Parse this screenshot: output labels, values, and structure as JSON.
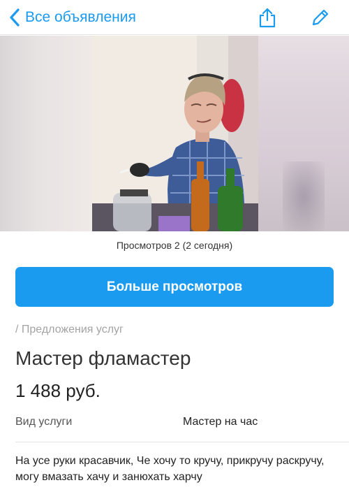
{
  "navbar": {
    "back_label": "Все объявления",
    "back_icon": "chevron-left-icon",
    "share_icon": "share-icon",
    "edit_icon": "pencil-icon",
    "accent_color": "#1a9bf0"
  },
  "gallery": {
    "photo_alt": "photo"
  },
  "views": "Просмотров 2 (2 сегодня)",
  "more_views_button": "Больше просмотров",
  "breadcrumb": "/ Предложения услуг",
  "title": "Мастер фламастер",
  "price": "1 488 руб.",
  "params": [
    {
      "label": "Вид услуги",
      "value": "Мастер на час"
    }
  ],
  "description": "На усе руки красавчик, Че хочу то кручу, прикручу раскручу, могу вмазать хачу и занюхать харчу"
}
